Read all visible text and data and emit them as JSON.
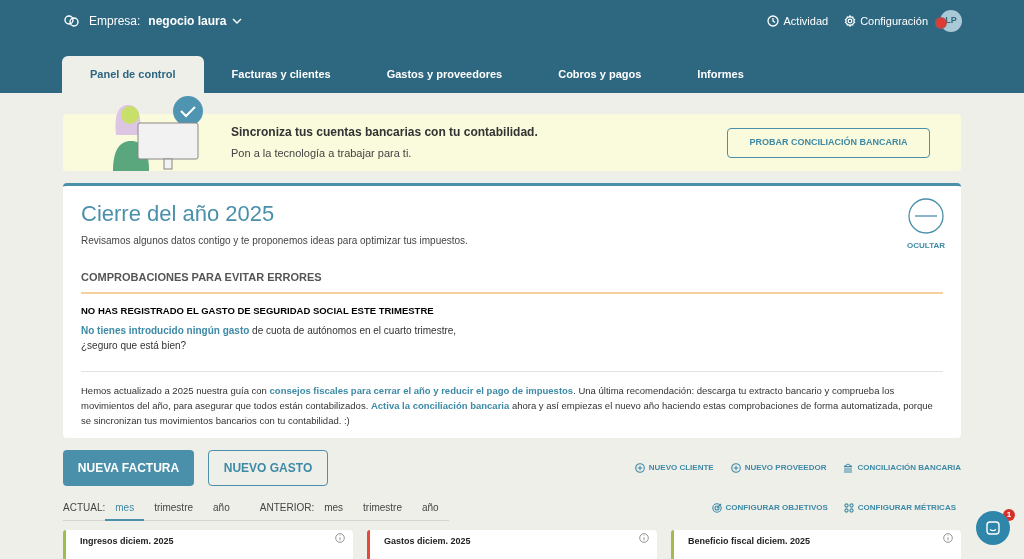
{
  "header": {
    "company_label": "Empresa:",
    "company_name": "negocio laura",
    "actions": [
      {
        "kind": "clock",
        "label": "Actividad"
      },
      {
        "kind": "gear",
        "label": "Configuración"
      }
    ],
    "avatar": "LP",
    "avatar_alert": true
  },
  "tabs": [
    {
      "label": "Panel de control",
      "selected": true
    },
    {
      "label": "Facturas y clientes",
      "selected": false
    },
    {
      "label": "Gastos y proveedores",
      "selected": false
    },
    {
      "label": "Cobros y pagos",
      "selected": false
    },
    {
      "label": "Informes",
      "selected": false
    }
  ],
  "banner": {
    "title": "Sincroniza tus cuentas bancarias con tu contabilidad.",
    "subtitle": "Pon a la tecnología a trabajar para ti.",
    "button": "PROBAR CONCILIACIÓN BANCARIA"
  },
  "year_close": {
    "title": "Cierre del año 2025",
    "subtitle": "Revisamos algunos datos contigo y te proponemos ideas para optimizar tus impuestos.",
    "hide_label": "OCULTAR",
    "section_title": "COMPROBACIONES PARA EVITAR ERRORES",
    "warning": {
      "title": "NO HAS REGISTRADO EL GASTO DE SEGURIDAD SOCIAL ESTE TRIMESTRE",
      "lines": [
        [
          {
            "text": "No tienes introducido ningún gasto",
            "link": true
          },
          {
            "text": " de cuota de autónomos en el cuarto trimestre,",
            "link": false
          }
        ],
        [
          {
            "text": "¿seguro que está bien?",
            "link": false
          }
        ]
      ]
    },
    "footer": [
      {
        "text": "Hemos actualizado a 2025 nuestra guía con ",
        "link": false
      },
      {
        "text": "consejos fiscales para cerrar el año y reducir el pago de impuestos",
        "link": true
      },
      {
        "text": ". Una última recomendación: descarga tu extracto bancario y comprueba los movimientos del año, para asegurar que todos están contabilizados. ",
        "link": false
      },
      {
        "text": "Activa la conciliación bancaria",
        "link": true
      },
      {
        "text": " ahora y así empiezas el nuevo año haciendo estas comprobaciones de forma automatizada, porque se sincronizan tus movimientos bancarios con tu contabilidad. :)",
        "link": false
      }
    ]
  },
  "actions": {
    "buttons": [
      {
        "label": "NUEVA FACTURA",
        "kind": "primary"
      },
      {
        "label": "NUEVO GASTO",
        "kind": "secondary"
      }
    ],
    "links": [
      {
        "kind": "plus",
        "label": "NUEVO CLIENTE"
      },
      {
        "kind": "plus",
        "label": "NUEVO PROVEEDOR"
      },
      {
        "kind": "bank",
        "label": "CONCILIACIÓN BANCARIA"
      }
    ]
  },
  "periods": [
    {
      "label": "ACTUAL:",
      "options": [
        {
          "label": "mes",
          "selected": true
        },
        {
          "label": "trimestre",
          "selected": false
        },
        {
          "label": "año",
          "selected": false
        }
      ]
    },
    {
      "label": "ANTERIOR:",
      "options": [
        {
          "label": "mes",
          "selected": false
        },
        {
          "label": "trimestre",
          "selected": false
        },
        {
          "label": "año",
          "selected": false
        }
      ]
    }
  ],
  "config_links": [
    {
      "kind": "target",
      "label": "CONFIGURAR OBJETIVOS"
    },
    {
      "kind": "grid",
      "label": "CONFIGURAR MÉTRICAS"
    }
  ],
  "metric_cards": [
    {
      "title": "Ingresos diciem. 2025",
      "color": "#9bc04a"
    },
    {
      "title": "Gastos diciem. 2025",
      "color": "#e5483c"
    },
    {
      "title": "Beneficio fiscal diciem. 2025",
      "color": "#a8b84a"
    }
  ],
  "chat": {
    "badge": "1"
  }
}
